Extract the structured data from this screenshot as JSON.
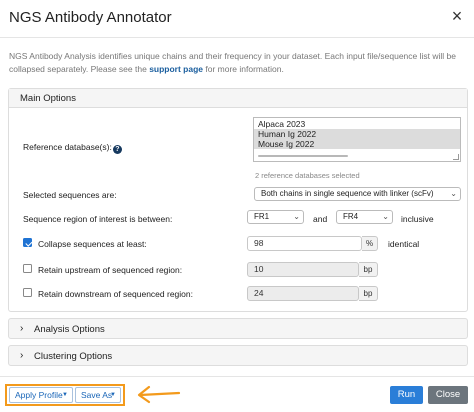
{
  "dialog": {
    "title": "NGS Antibody Annotator",
    "close_glyph": "×",
    "intro_text_1": "NGS Antibody Analysis identifies unique chains and their frequency in your dataset. Each input file/sequence list will be collapsed separately. Please see the ",
    "intro_link": "support page",
    "intro_text_2": " for more information."
  },
  "main_options": {
    "title": "Main Options",
    "reference_db": {
      "label": "Reference database(s):",
      "help_glyph": "?",
      "options": [
        {
          "label": "Alpaca 2023",
          "selected": false
        },
        {
          "label": "Human Ig 2022",
          "selected": true
        },
        {
          "label": "Mouse Ig 2022",
          "selected": true
        }
      ],
      "note": "2 reference databases selected"
    },
    "selected_sequences": {
      "label": "Selected sequences are:",
      "value": "Both chains in single sequence with linker (scFv)"
    },
    "region": {
      "label": "Sequence region of interest is between:",
      "from": "FR1",
      "and_label": "and",
      "to": "FR4",
      "suffix": "inclusive"
    },
    "collapse": {
      "label": "Collapse sequences at least:",
      "checked": true,
      "value": "98",
      "unit": "%",
      "suffix": "identical"
    },
    "upstream": {
      "label": "Retain upstream of sequenced region:",
      "checked": false,
      "value": "10",
      "unit": "bp"
    },
    "downstream": {
      "label": "Retain downstream of sequenced region:",
      "checked": false,
      "value": "24",
      "unit": "bp"
    }
  },
  "sections": {
    "analysis": "Analysis Options",
    "clustering": "Clustering Options"
  },
  "footer": {
    "apply_profile": "Apply Profile",
    "save_as": "Save As",
    "run": "Run",
    "close": "Close",
    "highlight_color": "#f39a1c"
  },
  "icons": {
    "chevron_down": "⌄",
    "chevron_right": "›",
    "caret": "▼"
  }
}
